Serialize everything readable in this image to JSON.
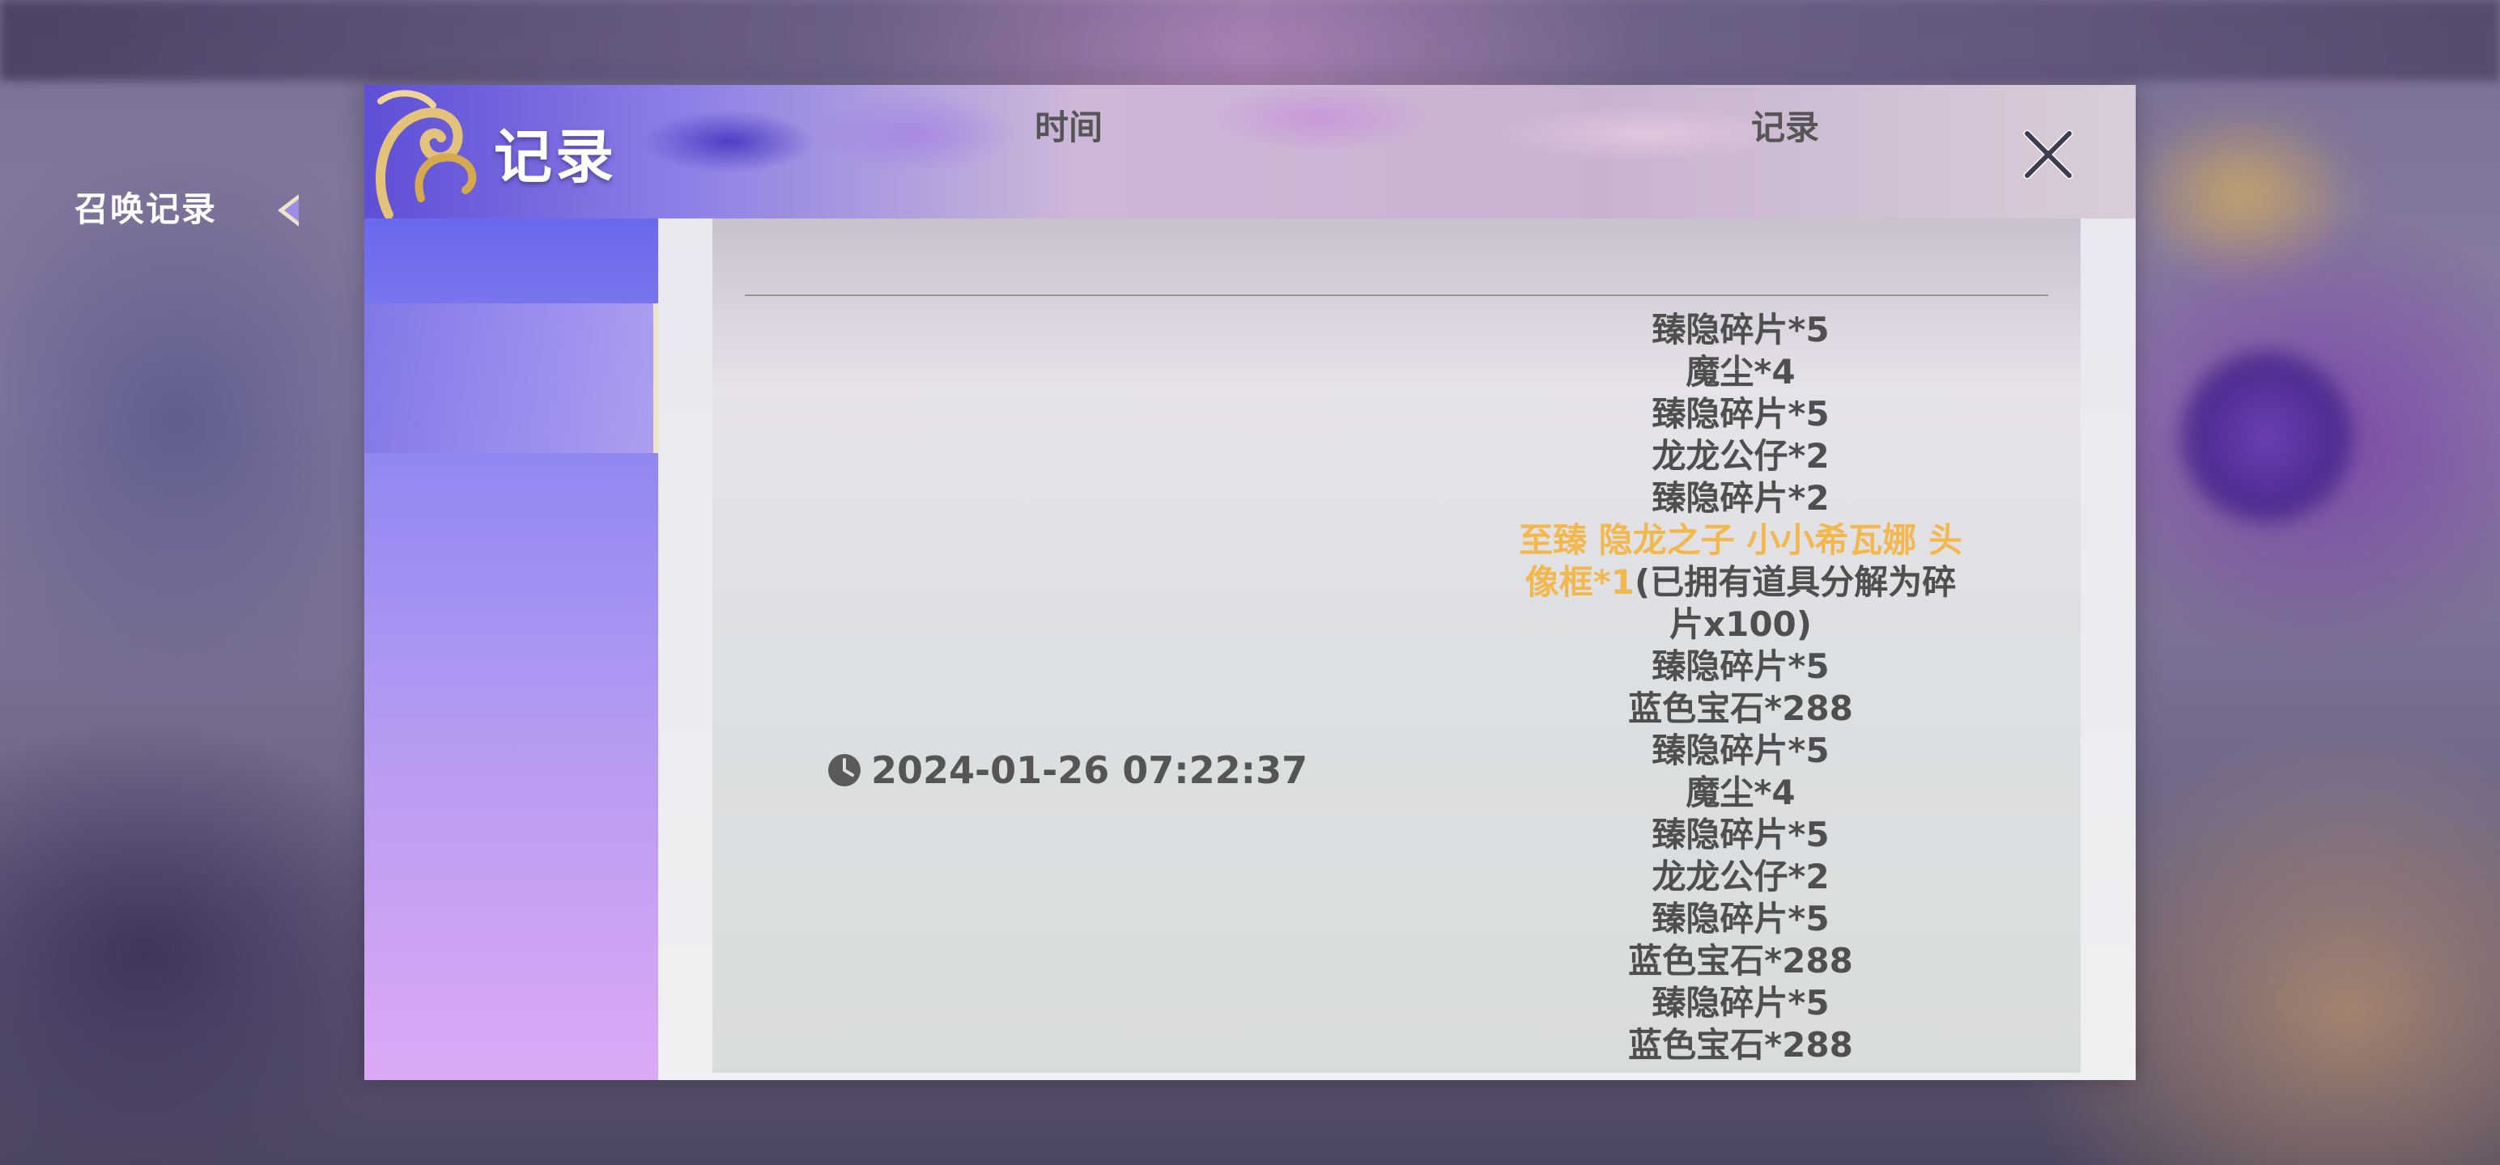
{
  "dialog": {
    "title": "记录",
    "close_label": "×"
  },
  "sidebar": {
    "items": [
      {
        "label": "召唤记录",
        "active": true
      }
    ]
  },
  "table": {
    "columns": [
      "时间",
      "记录"
    ],
    "rows": [
      {
        "time": "2024-01-26 07:22:37",
        "records": [
          "臻隐碎片*5",
          "魔尘*4",
          "臻隐碎片*5",
          "龙龙公仔*2",
          "臻隐碎片*2",
          {
            "highlight_lines": [
              "至臻 隐龙之子 小小希瓦娜 头",
              "像框*1"
            ],
            "suffix_line2": "(已拥有道具分解为碎",
            "suffix_line3": "片x100)"
          },
          "臻隐碎片*5",
          "蓝色宝石*288",
          "臻隐碎片*5",
          "魔尘*4",
          "臻隐碎片*5",
          "龙龙公仔*2",
          "臻隐碎片*5",
          "蓝色宝石*288",
          "臻隐碎片*5",
          "蓝色宝石*288"
        ]
      }
    ]
  },
  "colors": {
    "highlight": "#f2b84e",
    "text": "#4f4f4f",
    "sidebar_top": "#6b69ec",
    "sidebar_bottom": "#dba9f5"
  },
  "icons": {
    "close": "close-icon",
    "clock": "clock-icon",
    "logo": "golden-swirl-ornament-icon"
  }
}
